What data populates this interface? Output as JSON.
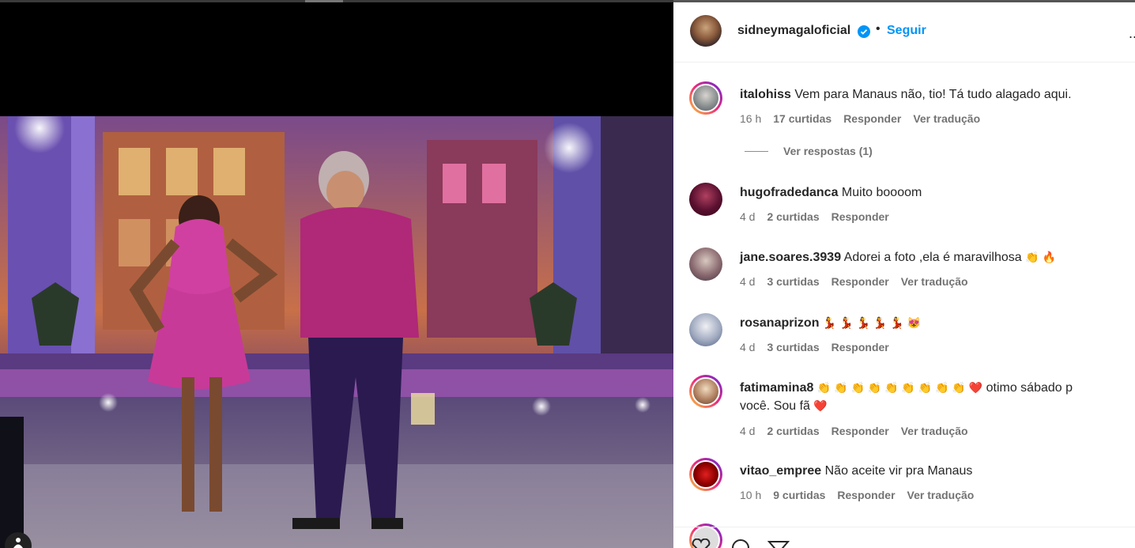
{
  "post": {
    "username": "sidneymagaloficial",
    "dot": "•",
    "follow_label": "Seguir",
    "more": "..."
  },
  "comments": [
    {
      "user": "italohiss",
      "text": "Vem para Manaus não, tio! Tá tudo alagado aqui.",
      "time": "16 h",
      "likes": "17 curtidas",
      "reply": "Responder",
      "translate": "Ver tradução",
      "avatar_colors": [
        "#c8c8c8",
        "#707a80"
      ]
    },
    {
      "user": "hugofradedanca",
      "text": "Muito boooom",
      "time": "4 d",
      "likes": "2 curtidas",
      "reply": "Responder",
      "translate": "",
      "avatar_colors": [
        "#3a1020",
        "#8a1030"
      ]
    },
    {
      "user": "jane.soares.3939",
      "text": "Adorei a foto ,ela é maravilhosa",
      "emoji": "👏 🔥",
      "time": "4 d",
      "likes": "3 curtidas",
      "reply": "Responder",
      "translate": "Ver tradução",
      "avatar_colors": [
        "#c0b8b0",
        "#806060"
      ]
    },
    {
      "user": "rosanaprizon",
      "text": "",
      "emoji": "💃 💃 💃 💃 💃 😻",
      "time": "4 d",
      "likes": "3 curtidas",
      "reply": "Responder",
      "translate": "",
      "avatar_colors": [
        "#e8e8ee",
        "#7080a0"
      ]
    },
    {
      "user": "fatimamina8",
      "text": "otimo sábado p",
      "emoji": "👏 👏 👏 👏 👏 👏 👏 👏 👏 ❤️",
      "text2": "você. Sou fã",
      "emoji2": "❤️",
      "time": "4 d",
      "likes": "2 curtidas",
      "reply": "Responder",
      "translate": "Ver tradução",
      "avatar_colors": [
        "#e0c8a0",
        "#705040"
      ]
    },
    {
      "user": "vitao_empree",
      "text": "Não aceite vir pra Manaus",
      "time": "10 h",
      "likes": "9 curtidas",
      "reply": "Responder",
      "translate": "Ver tradução",
      "avatar_colors": [
        "#c01818",
        "#400000"
      ]
    }
  ],
  "replies_label": "Ver respostas (1)",
  "icons": [
    "user-tag-icon",
    "verified-icon",
    "more-icon",
    "heart-icon",
    "comment-icon",
    "share-icon"
  ],
  "colors": {
    "accent": "#0095f6",
    "text": "#262626",
    "muted": "#737373"
  }
}
